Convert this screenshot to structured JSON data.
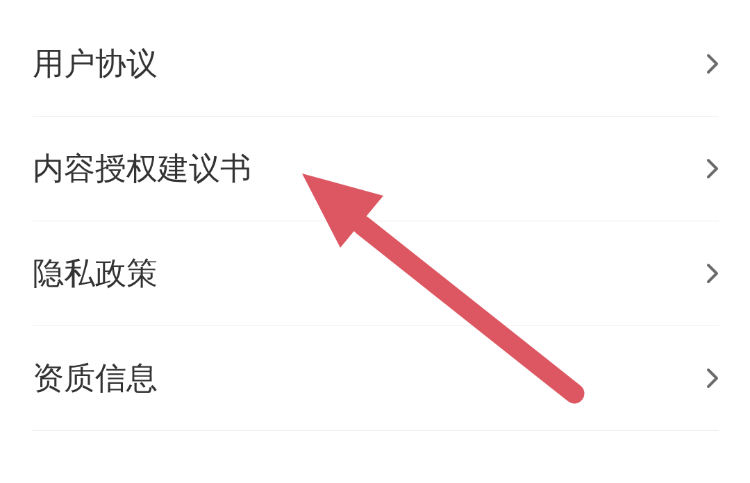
{
  "items": [
    {
      "label": "用户协议"
    },
    {
      "label": "内容授权建议书"
    },
    {
      "label": "隐私政策"
    },
    {
      "label": "资质信息"
    }
  ]
}
